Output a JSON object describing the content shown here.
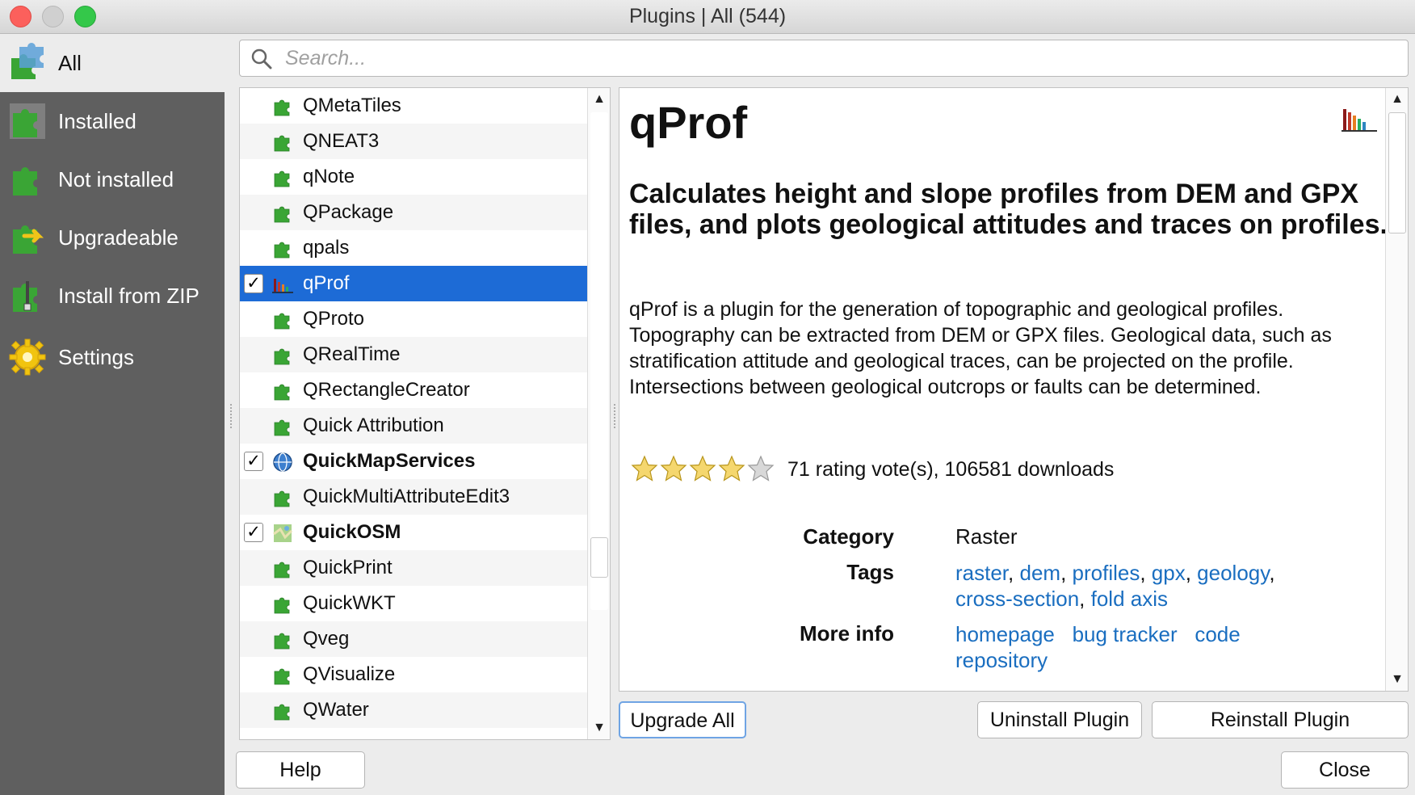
{
  "window": {
    "title": "Plugins | All (544)"
  },
  "sidebar": {
    "items": [
      {
        "label": "All",
        "icon": "puzzle-all-icon"
      },
      {
        "label": "Installed",
        "icon": "puzzle-installed-icon"
      },
      {
        "label": "Not installed",
        "icon": "puzzle-not-installed-icon"
      },
      {
        "label": "Upgradeable",
        "icon": "puzzle-upgradeable-icon"
      },
      {
        "label": "Install from ZIP",
        "icon": "zip-icon"
      },
      {
        "label": "Settings",
        "icon": "gear-icon"
      }
    ]
  },
  "search": {
    "placeholder": "Search..."
  },
  "plugins": [
    {
      "name": "QMetaTiles"
    },
    {
      "name": "QNEAT3"
    },
    {
      "name": "qNote"
    },
    {
      "name": "QPackage"
    },
    {
      "name": "qpals"
    },
    {
      "name": "qProf",
      "checked": "✓",
      "selected": true
    },
    {
      "name": "QProto"
    },
    {
      "name": "QRealTime"
    },
    {
      "name": "QRectangleCreator"
    },
    {
      "name": "Quick Attribution"
    },
    {
      "name": "QuickMapServices",
      "checked": "✓",
      "bold": true
    },
    {
      "name": "QuickMultiAttributeEdit3"
    },
    {
      "name": "QuickOSM",
      "checked": "✓",
      "bold": true
    },
    {
      "name": "QuickPrint"
    },
    {
      "name": "QuickWKT"
    },
    {
      "name": "Qveg"
    },
    {
      "name": "QVisualize"
    },
    {
      "name": "QWater"
    }
  ],
  "detail": {
    "title": "qProf",
    "subtitle": "Calculates height and slope profiles from DEM and GPX files, and plots geological attitudes and traces on profiles.",
    "description": "qProf is a plugin for the generation of topographic and geological profiles. Topography can be extracted from DEM or GPX files. Geological data, such as stratification attitude and geological traces, can be projected on the profile. Intersections between geological outcrops or faults can be determined.",
    "stars_filled": 4,
    "stars_total": 5,
    "rating_text": "71 rating vote(s), 106581 downloads",
    "category_label": "Category",
    "category_value": "Raster",
    "tags_label": "Tags",
    "tags": [
      "raster",
      "dem",
      "profiles",
      "gpx",
      "geology",
      "cross-section",
      "fold axis"
    ],
    "more_info_label": "More info",
    "links": {
      "homepage": "homepage",
      "bug_tracker": "bug tracker",
      "code": "code",
      "repository": "repository"
    }
  },
  "buttons": {
    "upgrade_all": "Upgrade All",
    "uninstall": "Uninstall Plugin",
    "reinstall": "Reinstall Plugin",
    "help": "Help",
    "close": "Close"
  },
  "colors": {
    "selection": "#1d6bd6",
    "sidebar": "#5f5f5f",
    "link": "#1a6ec0",
    "plugin_green": "#3aa535"
  }
}
